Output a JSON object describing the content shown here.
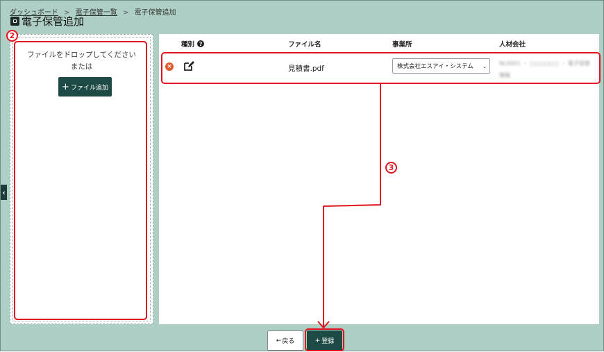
{
  "breadcrumb": {
    "items": [
      "ダッシュボード",
      "電子保管一覧"
    ],
    "current": "電子保管追加",
    "separator": ">"
  },
  "page": {
    "title": "電子保管追加"
  },
  "dropzone": {
    "text": "ファイルをドロップしてください",
    "or_text": "または",
    "add_button": "ファイル追加"
  },
  "table": {
    "headers": {
      "type": "種別",
      "file_name": "ファイル名",
      "office": "事業所",
      "hr_company": "人材会社"
    },
    "rows": [
      {
        "file_name": "見積書.pdf",
        "office": "株式会社エスアイ・システム",
        "hr_company": "NL0001 ・ ○○○○○○ ・ 電子保管",
        "hr_company_line2": "情報"
      }
    ]
  },
  "footer": {
    "back_button": "戻る",
    "register_button": "登録"
  },
  "annotations": {
    "dropzone_step": "2",
    "row_step": "3"
  },
  "colors": {
    "background": "#aecfc5",
    "primary": "#1d4a44",
    "annotation": "#e0141e",
    "remove": "#e05a2b"
  },
  "icons": [
    "page-icon",
    "help-icon",
    "remove-icon",
    "edit-icon",
    "chevron-down-icon",
    "arrow-left-icon",
    "plus-icon",
    "chevron-left-icon"
  ]
}
